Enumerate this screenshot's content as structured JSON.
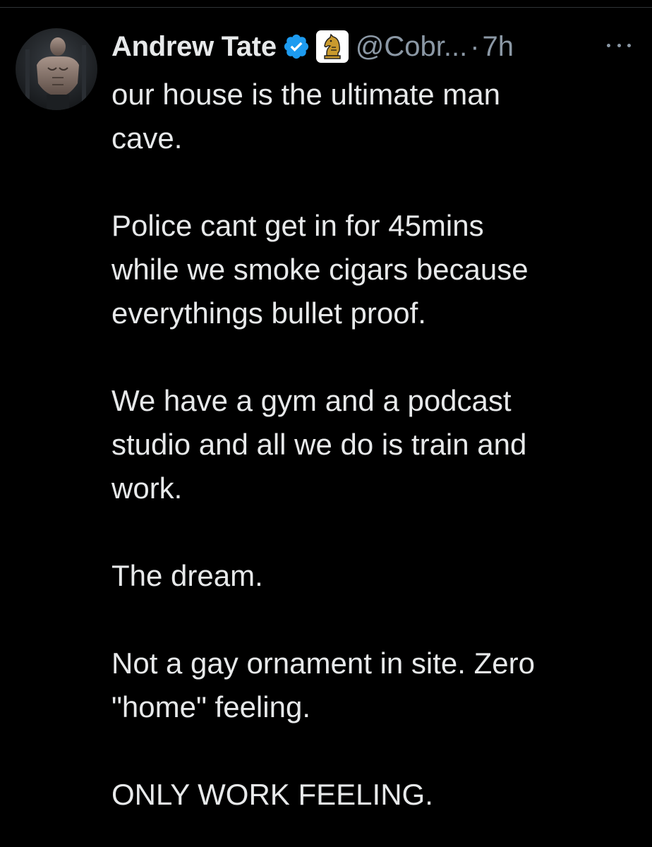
{
  "tweet": {
    "author": {
      "display_name": "Andrew Tate",
      "handle": "@Cobr...",
      "verified": true,
      "verified_icon": "verified-checkmark-icon",
      "affiliate_icon": "chess-knight-icon"
    },
    "separator": "·",
    "timestamp": "7h",
    "more_icon": "more-options-icon",
    "paragraphs": [
      [
        "our house is the ultimate man",
        "cave."
      ],
      [
        "Police cant get in for 45mins",
        "while we smoke cigars because",
        "everythings bullet proof."
      ],
      [
        "We have a gym and a podcast",
        "studio and all we do is train and",
        "work."
      ],
      [
        "The dream."
      ],
      [
        "Not a gay ornament in site. Zero",
        "\"home\" feeling."
      ],
      [
        "ONLY WORK FEELING."
      ]
    ]
  },
  "colors": {
    "background": "#000000",
    "text_primary": "#e7e9ea",
    "text_secondary": "#8b98a5",
    "verified_blue": "#1d9bf0",
    "divider": "#2f3336"
  }
}
